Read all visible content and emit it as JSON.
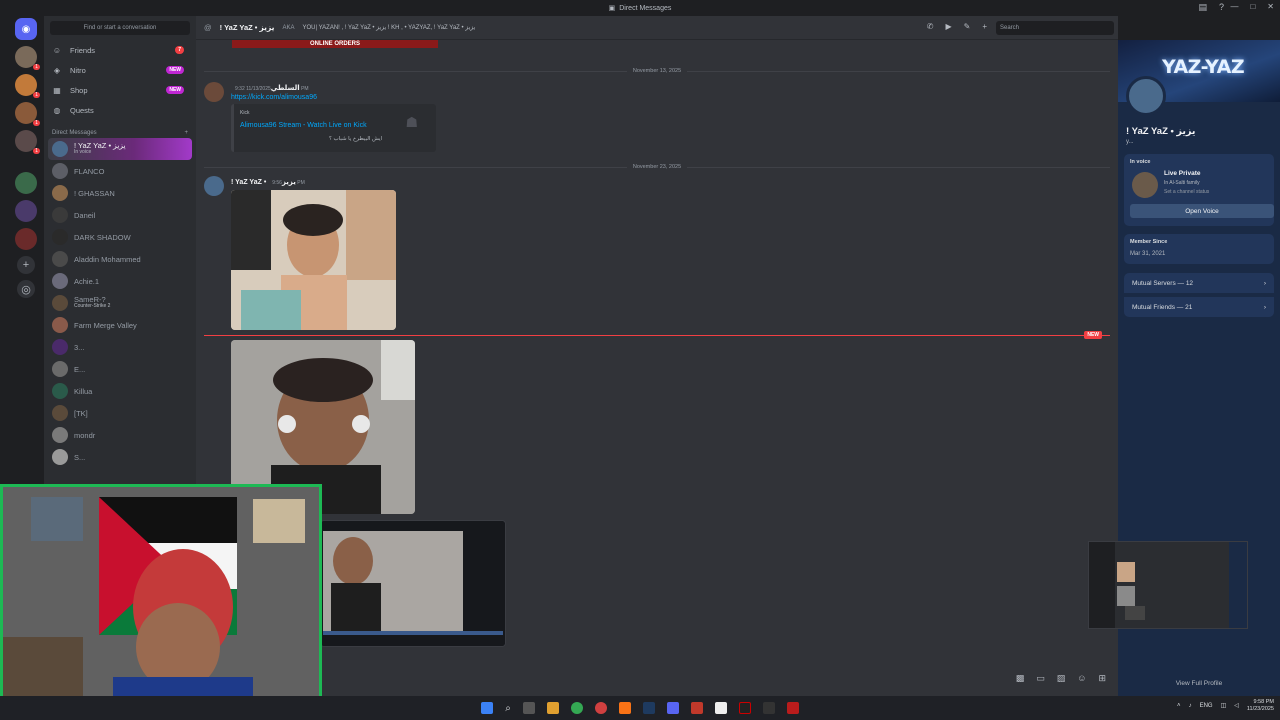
{
  "window": {
    "title": "Direct Messages"
  },
  "sidebar": {
    "search_placeholder": "Find or start a conversation",
    "nav": [
      {
        "label": "Friends",
        "badge": "7",
        "icon": "friends-icon"
      },
      {
        "label": "Nitro",
        "badge": "NEW",
        "icon": "nitro-icon"
      },
      {
        "label": "Shop",
        "badge": "NEW",
        "icon": "shop-icon"
      },
      {
        "label": "Quests",
        "badge": "",
        "icon": "quests-icon"
      }
    ],
    "dm_header": "Direct Messages",
    "dms": [
      {
        "name": "! YaZ YaZ • يزيز",
        "sub": "In voice"
      },
      {
        "name": "FLANCO",
        "sub": ""
      },
      {
        "name": "! GHASSAN",
        "sub": ""
      },
      {
        "name": "Daneil",
        "sub": ""
      },
      {
        "name": "DARK SHADOW",
        "sub": ""
      },
      {
        "name": "Aladdin Mohammed",
        "sub": ""
      },
      {
        "name": "Achie.1",
        "sub": ""
      },
      {
        "name": "SameR-?",
        "sub": "Counter-Strike 2"
      },
      {
        "name": "Farm Merge Valley",
        "sub": ""
      },
      {
        "name": "3...",
        "sub": ""
      },
      {
        "name": "E...",
        "sub": ""
      },
      {
        "name": "Killua",
        "sub": ""
      },
      {
        "name": "[TK]",
        "sub": ""
      },
      {
        "name": "mondr",
        "sub": ""
      },
      {
        "name": "S...",
        "sub": ""
      }
    ],
    "server_badges": [
      "1",
      "1",
      "1",
      "1"
    ]
  },
  "chat_header": {
    "name": "! YaZ YaZ • يزيز",
    "aka": "AKA",
    "aliases": "YOU| YAZAN! , ! YaZ YaZ • يزيز ! KH , • YAZYAZ, ! YaZ YaZ • يزيز",
    "search_placeholder": "Search"
  },
  "messages": {
    "banner_text": "ONLINE ORDERS",
    "date1": "November 13, 2025",
    "msg1": {
      "author": "السلطي",
      "time": "11/13/2025 9:32 PM",
      "link": "https://kick.com/alimousa96",
      "embed_provider": "Kick",
      "embed_title": "Alimousa96 Stream - Watch Live on Kick",
      "embed_desc": "ايش البيطرخ يا شباب ؟"
    },
    "date2": "November 23, 2025",
    "msg2": {
      "author": "! YaZ YaZ • يزيز",
      "time": "9:56 PM"
    },
    "new_label": "NEW"
  },
  "profile": {
    "banner_title": "YAZ-YAZ",
    "name": "! YaZ YaZ • يزيز",
    "username": "y...",
    "in_voice_label": "In voice",
    "voice_channel": "Live Private",
    "voice_server": "In Al-Salti family",
    "status_prompt": "Set a channel status",
    "open_voice": "Open Voice",
    "member_since_label": "Member Since",
    "member_since": "Mar 31, 2021",
    "mutual_servers": "Mutual Servers — 12",
    "mutual_friends": "Mutual Friends — 21",
    "view_full": "View Full Profile"
  },
  "taskbar": {
    "lang": "ENG",
    "time": "9:58 PM",
    "date": "11/23/2025"
  },
  "colors": {
    "accent": "#5865f2",
    "new_red": "#f23f43",
    "link_blue": "#00a8fc",
    "nitro_pink": "#c026d3"
  }
}
